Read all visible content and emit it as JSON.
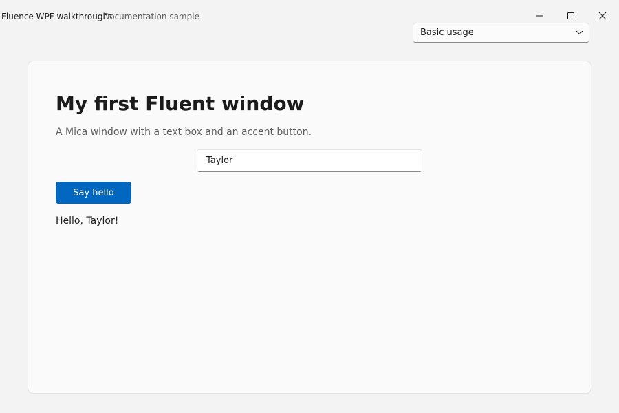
{
  "window": {
    "title": "Fluence WPF walkthroughs",
    "subtitle": "Documentation sample",
    "icons": {
      "minimize": "minimize-icon",
      "maximize": "maximize-icon",
      "close": "close-icon"
    }
  },
  "scenario_select": {
    "value": "Basic usage",
    "icon": "chevron-down-icon"
  },
  "card": {
    "title": "My first Fluent window",
    "description": "A Mica window with a text box and an accent button.",
    "name_input": {
      "value": "Taylor",
      "placeholder": ""
    },
    "say_hello_label": "Say hello",
    "greeting": "Hello, Taylor!"
  },
  "colors": {
    "accent": "#0067c0",
    "window_background": "#f3f3f3",
    "card_background": "#fafafa",
    "text_primary": "#1b1b1b",
    "text_secondary": "#5d5d5d"
  }
}
